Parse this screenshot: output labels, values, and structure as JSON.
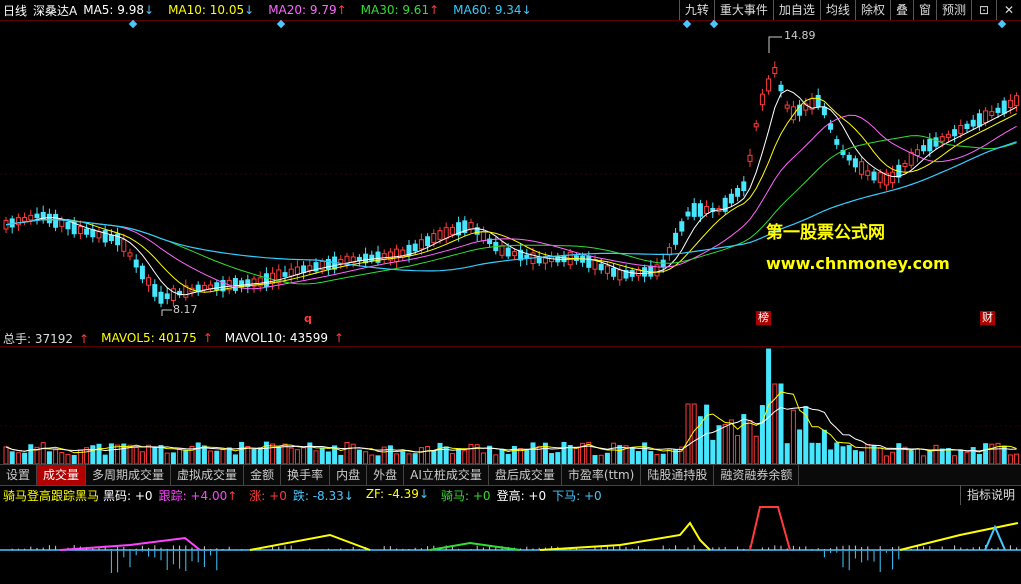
{
  "topbar": {
    "period": "日线",
    "stock": "深桑达A",
    "ma": [
      {
        "label": "MA5: 9.98",
        "dir": "down",
        "color": "#ffffff"
      },
      {
        "label": "MA10: 10.05",
        "dir": "down",
        "color": "#ffff00"
      },
      {
        "label": "MA20: 9.79",
        "dir": "up",
        "color": "#ff66ff"
      },
      {
        "label": "MA30: 9.61",
        "dir": "up",
        "color": "#33dd33"
      },
      {
        "label": "MA60: 9.34",
        "dir": "down",
        "color": "#33ccff"
      }
    ],
    "buttons": [
      "九转",
      "重大事件",
      "加自选",
      "均线",
      "除权",
      "叠",
      "窗",
      "预测"
    ],
    "lock_icon": "lock-icon",
    "close_icon": "close-icon"
  },
  "main": {
    "high_label": "14.89",
    "low_label": "8.17",
    "marker_q": "q",
    "badge_bang": "榜",
    "badge_cai": "财",
    "watermark_cn": "第一股票公式网",
    "watermark_url": "www.chnmoney.com",
    "colors": {
      "up": "#ff3b3b",
      "down": "#46e6ff",
      "ma5": "#ffffff",
      "ma10": "#ffff00",
      "ma20": "#ff66ff",
      "ma30": "#33dd33",
      "ma60": "#33ccff"
    }
  },
  "volume": {
    "total": "总手: 37192",
    "mavol5": "MAVOL5: 40175",
    "mavol10": "MAVOL10: 43599"
  },
  "tabs": [
    "设置",
    "成交量",
    "多周期成交量",
    "虚拟成交量",
    "金额",
    "换手率",
    "内盘",
    "外盘",
    "AI立桩成交量",
    "盘后成交量",
    "市盈率(ttm)",
    "陆股通持股",
    "融资融券余额"
  ],
  "active_tab": "成交量",
  "indicator": {
    "name": "骑马登高跟踪黑马",
    "items": [
      {
        "label": "黑码: +0",
        "color": "#ffffff",
        "dir": ""
      },
      {
        "label": "跟踪: +4.00",
        "color": "#ff44ff",
        "dir": "up"
      },
      {
        "label": "涨: +0",
        "color": "#ff3b3b",
        "dir": ""
      },
      {
        "label": "跌: -8.33",
        "color": "#46c7ff",
        "dir": "down"
      },
      {
        "label": "ZF: -4.39",
        "color": "#ffff00",
        "dir": "down"
      },
      {
        "label": "骑马: +0",
        "color": "#33dd33",
        "dir": ""
      },
      {
        "label": "登高: +0",
        "color": "#ffffff",
        "dir": ""
      },
      {
        "label": "下马: +0",
        "color": "#46c7ff",
        "dir": ""
      }
    ],
    "help": "指标说明"
  }
}
